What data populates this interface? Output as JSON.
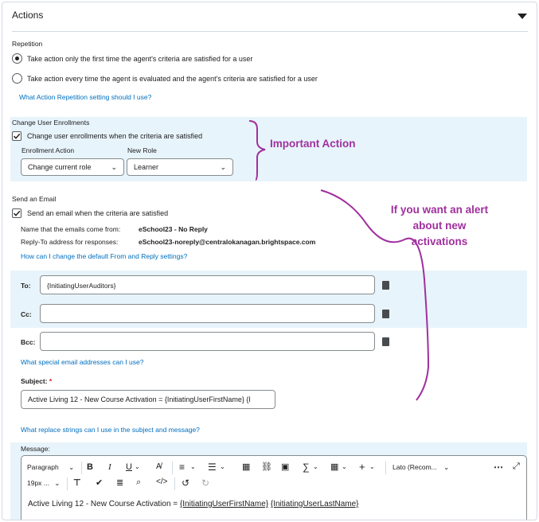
{
  "section_title": "Actions",
  "repetition": {
    "heading": "Repetition",
    "option_first": "Take action only the first time the agent's criteria are satisfied for a user",
    "option_every": "Take action every time the agent is evaluated and the agent's criteria are satisfied for a user",
    "help_link": "What Action Repetition setting should I use?"
  },
  "enrollments": {
    "heading": "Change User Enrollments",
    "checkbox_label": "Change user enrollments when the criteria are satisfied",
    "action_label": "Enrollment Action",
    "action_value": "Change current role",
    "role_label": "New Role",
    "role_value": "Learner"
  },
  "email": {
    "heading": "Send an Email",
    "checkbox_label": "Send an email when the criteria are satisfied",
    "from_label": "Name that the emails come from:",
    "from_value": "eSchool23 - No Reply",
    "reply_label": "Reply-To address for responses:",
    "reply_value": "eSchool23-noreply@centralokanagan.brightspace.com",
    "change_link": "How can I change the default From and Reply settings?",
    "to_label": "To:",
    "to_value": "{InitiatingUserAuditors}",
    "cc_label": "Cc:",
    "cc_value": "",
    "bcc_label": "Bcc:",
    "bcc_value": "",
    "special_link": "What special email addresses can I use?",
    "subject_label": "Subject:",
    "subject_required": "*",
    "subject_value": "Active Living 12 - New Course Activation = {InitiatingUserFirstName} {I",
    "replace_link": "What replace strings can I use in the subject and message?",
    "message_label": "Message:",
    "message_prefix": "Active Living 12 - New Course Activation = ",
    "message_token1": "{InitiatingUserFirstName}",
    "message_token2": "{InitiatingUserLastName}"
  },
  "toolbar": {
    "paragraph": "Paragraph",
    "font": "Lato (Recom...",
    "size": "19px ..."
  },
  "annotations": {
    "important": "Important Action",
    "alert": "If you want an alert about new activations"
  },
  "colors": {
    "accent": "#006fbf",
    "band": "#e8f4fb",
    "annotation": "#a0309e"
  }
}
